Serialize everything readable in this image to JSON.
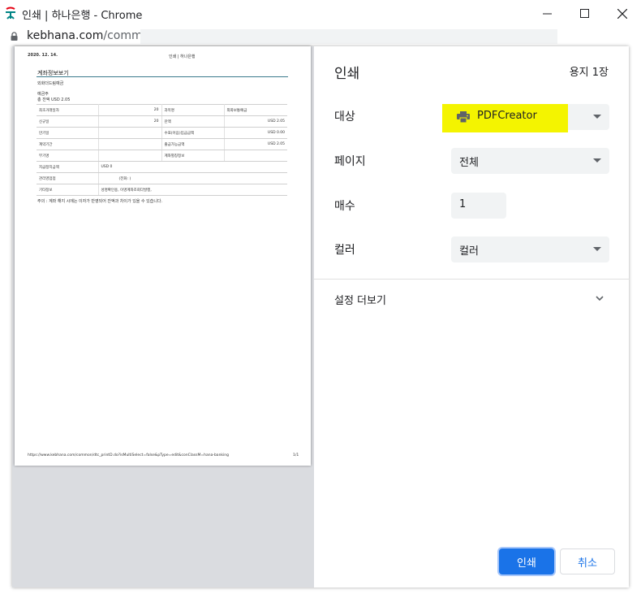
{
  "window": {
    "title": "인쇄 | 하나은행 - Chrome",
    "minimize": "—",
    "maximize": "☐",
    "close": "✕"
  },
  "address": {
    "host": "kebhana.com",
    "path": "/commo"
  },
  "dialog": {
    "title": "인쇄",
    "sheets": "용지 1장",
    "destination_label": "대상",
    "destination_value": "PDFCreator",
    "pages_label": "페이지",
    "pages_value": "전체",
    "copies_label": "매수",
    "copies_value": "1",
    "color_label": "컬러",
    "color_value": "컬러",
    "more_settings": "설정 더보기",
    "print_button": "인쇄",
    "cancel_button": "취소",
    "highlight_color": "#f4f400",
    "accent_color": "#1a73e8"
  },
  "preview": {
    "date": "2020. 12. 14.",
    "header": "인쇄 | 하나은행",
    "title": "계좌정보보기",
    "account_name": "외화더드림예금",
    "owner": "예금주",
    "balance": "총 잔액 USD      2.05",
    "rows": [
      [
        "최초거래일자",
        "20",
        "과목명",
        "외화보통예금"
      ],
      [
        "신규일",
        "20",
        "잔액",
        "USD      2.05"
      ],
      [
        "만기일",
        "",
        "수표(어음)입금금액",
        "USD 0.00"
      ],
      [
        "계약기간",
        "",
        "출금가능금액",
        "USD      2.05"
      ],
      [
        "부기명",
        "",
        "계좌별칭정보",
        ""
      ],
      [
        "지급정지금액",
        "USD 0",
        "",
        ""
      ],
      [
        "관리영업점",
        "(전화:          )",
        "",
        ""
      ],
      [
        "기타정보",
        "성명확인용, 이명계좌조회다발행,",
        "",
        ""
      ]
    ],
    "note": "주의 : 계좌 해지 시에는 이자가 반영되어 잔액과 차이가 있을 수 있습니다.",
    "footer_url": "https://www.kebhana.com/common/dtc_printD.do?isMultiSelect=false&pType=edit&conClassM=hana-banking",
    "footer_page": "1/1"
  }
}
